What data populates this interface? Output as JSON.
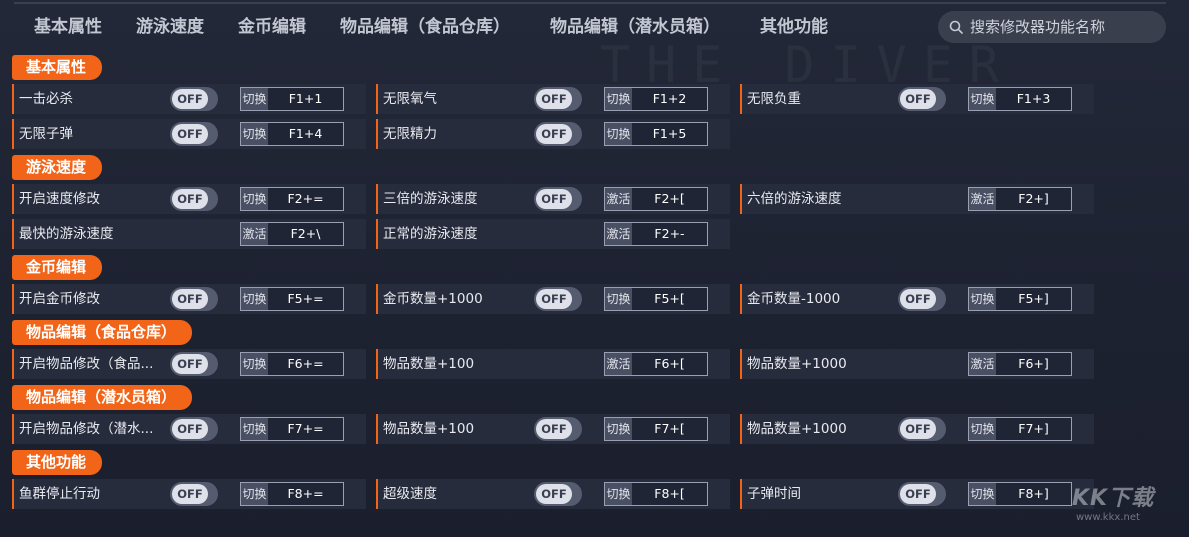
{
  "nav": {
    "tabs": [
      "基本属性",
      "游泳速度",
      "金币编辑",
      "物品编辑（食品仓库）",
      "物品编辑（潜水员箱）",
      "其他功能"
    ]
  },
  "search": {
    "placeholder": "搜索修改器功能名称"
  },
  "background_text": "THE DIVER",
  "brand": {
    "logo_text": "KK下载",
    "url": "www.kkx.net"
  },
  "sections": [
    {
      "title": "基本属性",
      "items": [
        {
          "name": "一击必杀",
          "toggle": "OFF",
          "mode": "切换",
          "key": "F1+1"
        },
        {
          "name": "无限氧气",
          "toggle": "OFF",
          "mode": "切换",
          "key": "F1+2"
        },
        {
          "name": "无限负重",
          "toggle": "OFF",
          "mode": "切换",
          "key": "F1+3"
        },
        {
          "name": "无限子弹",
          "toggle": "OFF",
          "mode": "切换",
          "key": "F1+4"
        },
        {
          "name": "无限精力",
          "toggle": "OFF",
          "mode": "切换",
          "key": "F1+5"
        }
      ]
    },
    {
      "title": "游泳速度",
      "items": [
        {
          "name": "开启速度修改",
          "toggle": "OFF",
          "mode": "切换",
          "key": "F2+="
        },
        {
          "name": "三倍的游泳速度",
          "toggle": "OFF",
          "mode": "激活",
          "key": "F2+["
        },
        {
          "name": "六倍的游泳速度",
          "toggle": null,
          "mode": "激活",
          "key": "F2+]"
        },
        {
          "name": "最快的游泳速度",
          "toggle": null,
          "mode": "激活",
          "key": "F2+\\"
        },
        {
          "name": "正常的游泳速度",
          "toggle": null,
          "mode": "激活",
          "key": "F2+-"
        }
      ]
    },
    {
      "title": "金币编辑",
      "items": [
        {
          "name": "开启金币修改",
          "toggle": "OFF",
          "mode": "切换",
          "key": "F5+="
        },
        {
          "name": "金币数量+1000",
          "toggle": "OFF",
          "mode": "切换",
          "key": "F5+["
        },
        {
          "name": "金币数量-1000",
          "toggle": "OFF",
          "mode": "切换",
          "key": "F5+]"
        }
      ]
    },
    {
      "title": "物品编辑（食品仓库）",
      "items": [
        {
          "name": "开启物品修改（食品...",
          "toggle": "OFF",
          "mode": "切换",
          "key": "F6+="
        },
        {
          "name": "物品数量+100",
          "toggle": null,
          "mode": "激活",
          "key": "F6+["
        },
        {
          "name": "物品数量+1000",
          "toggle": null,
          "mode": "激活",
          "key": "F6+]"
        }
      ]
    },
    {
      "title": "物品编辑（潜水员箱）",
      "items": [
        {
          "name": "开启物品修改（潜水...",
          "toggle": "OFF",
          "mode": "切换",
          "key": "F7+="
        },
        {
          "name": "物品数量+100",
          "toggle": "OFF",
          "mode": "切换",
          "key": "F7+["
        },
        {
          "name": "物品数量+1000",
          "toggle": "OFF",
          "mode": "切换",
          "key": "F7+]"
        }
      ]
    },
    {
      "title": "其他功能",
      "items": [
        {
          "name": "鱼群停止行动",
          "toggle": "OFF",
          "mode": "切换",
          "key": "F8+="
        },
        {
          "name": "超级速度",
          "toggle": "OFF",
          "mode": "切换",
          "key": "F8+["
        },
        {
          "name": "子弹时间",
          "toggle": "OFF",
          "mode": "切换",
          "key": "F8+]"
        }
      ]
    }
  ]
}
